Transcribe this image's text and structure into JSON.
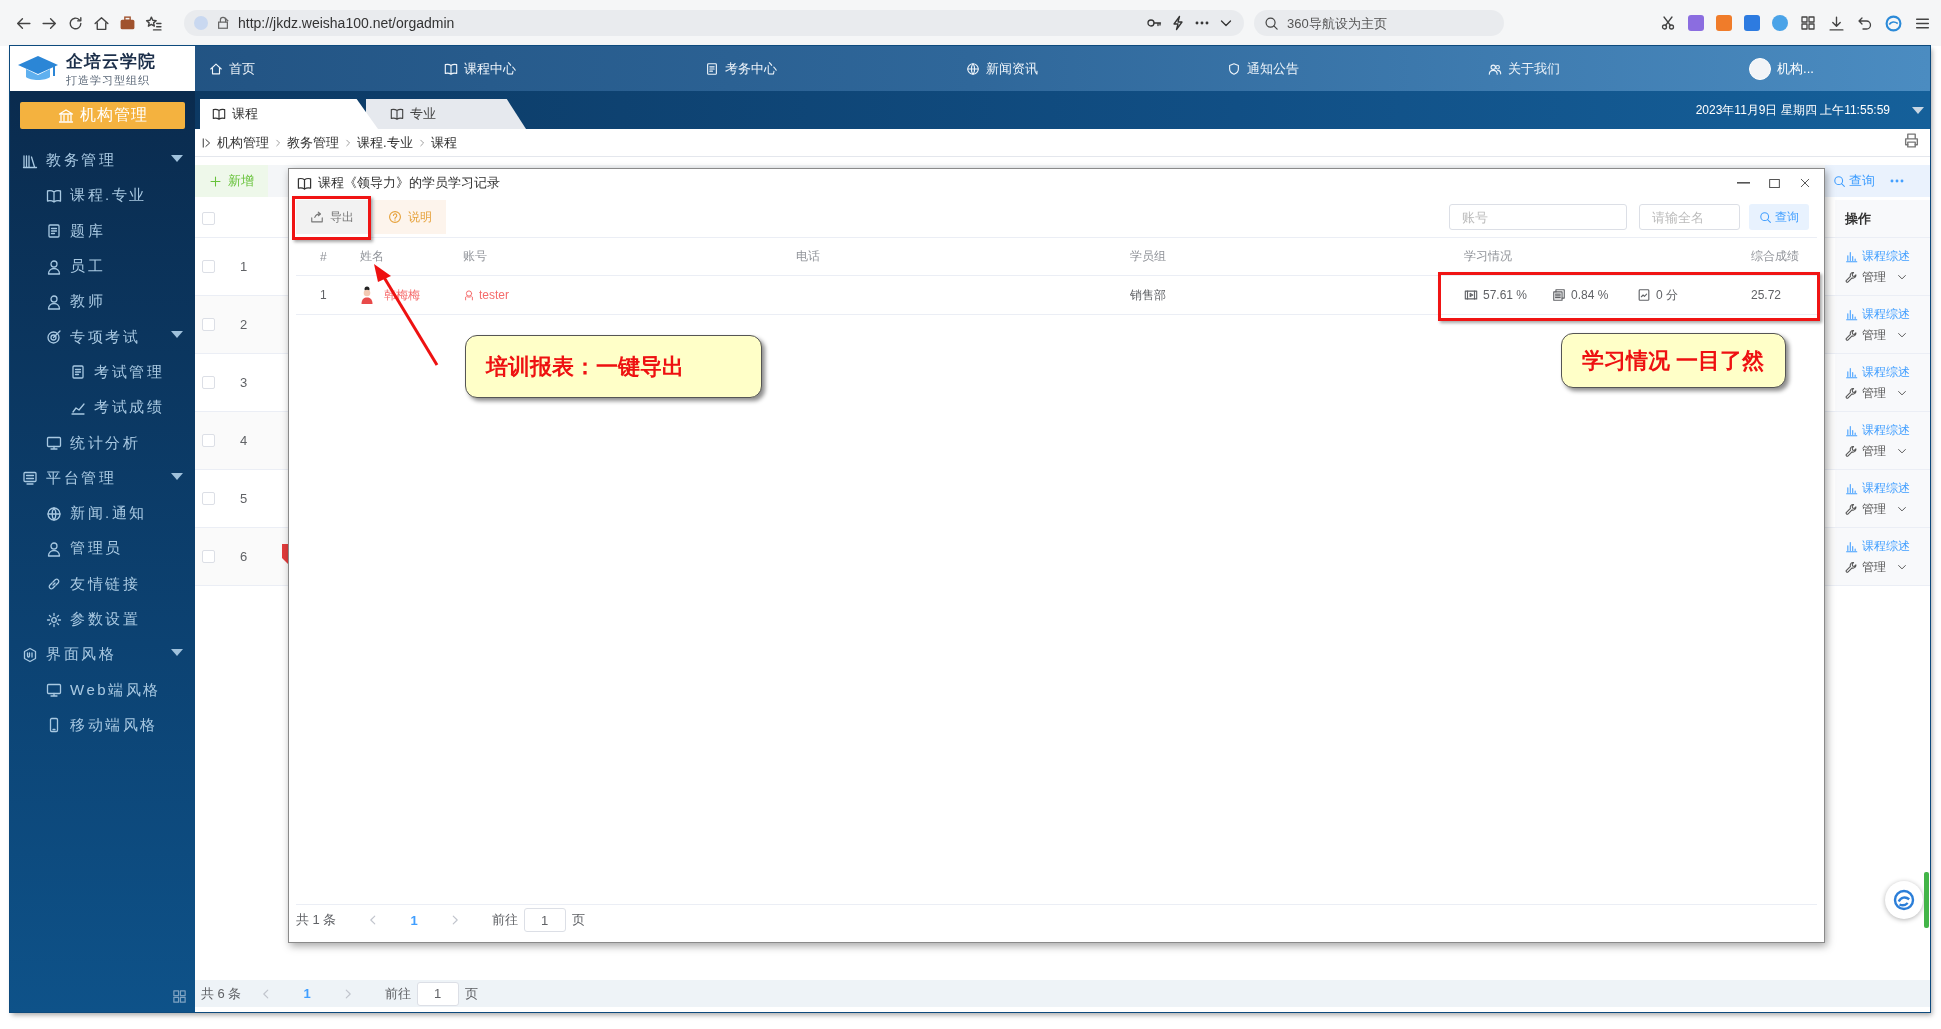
{
  "browser": {
    "url": "http://jkdz.weisha100.net/orgadmin",
    "search": {
      "placeholder": "360导航设为主页"
    }
  },
  "header": {
    "logo_title": "企培云学院",
    "logo_subtitle": "打造学习型组织",
    "user": "机构...",
    "nav": [
      {
        "label": "首页"
      },
      {
        "label": "课程中心"
      },
      {
        "label": "考务中心"
      },
      {
        "label": "新闻资讯"
      },
      {
        "label": "通知公告"
      },
      {
        "label": "关于我们"
      }
    ]
  },
  "tabs": [
    {
      "label": "课程",
      "selected": true
    },
    {
      "label": "专业",
      "selected": false
    }
  ],
  "datetime": "2023年11月9日 星期四 上午11:55:59",
  "sidebar": {
    "title": "机构管理",
    "items": [
      {
        "label": "教务管理",
        "expanded": true,
        "children": [
          {
            "label": "课程.专业"
          },
          {
            "label": "题库"
          },
          {
            "label": "员工"
          },
          {
            "label": "教师"
          },
          {
            "label": "专项考试",
            "expanded": true,
            "children": [
              {
                "label": "考试管理"
              },
              {
                "label": "考试成绩"
              }
            ]
          },
          {
            "label": "统计分析"
          }
        ]
      },
      {
        "label": "平台管理",
        "expanded": true,
        "children": [
          {
            "label": "新闻.通知"
          },
          {
            "label": "管理员"
          },
          {
            "label": "友情链接"
          },
          {
            "label": "参数设置"
          }
        ]
      },
      {
        "label": "界面风格",
        "expanded": true,
        "children": [
          {
            "label": "Web端风格"
          },
          {
            "label": "移动端风格"
          }
        ]
      }
    ]
  },
  "breadcrumb": [
    "机构管理",
    "教务管理",
    "课程.专业",
    "课程"
  ],
  "main": {
    "add_button": "新增",
    "search_button": "查询",
    "actions_column": "操作",
    "select_all_checked": false,
    "rows": [
      {
        "index": "1",
        "checked": false,
        "tagged": false,
        "link": "课程综述",
        "manage": "管理"
      },
      {
        "index": "2",
        "checked": false,
        "tagged": false,
        "link": "课程综述",
        "manage": "管理"
      },
      {
        "index": "3",
        "checked": false,
        "tagged": false,
        "link": "课程综述",
        "manage": "管理"
      },
      {
        "index": "4",
        "checked": false,
        "tagged": false,
        "link": "课程综述",
        "manage": "管理"
      },
      {
        "index": "5",
        "checked": false,
        "tagged": false,
        "link": "课程综述",
        "manage": "管理"
      },
      {
        "index": "6",
        "checked": false,
        "tagged": true,
        "link": "课程综述",
        "manage": "管理"
      }
    ],
    "pagination": {
      "total": "共 6 条",
      "current": "1",
      "goto": "前往",
      "goto_value": "1",
      "suffix": "页"
    }
  },
  "dialog": {
    "title": "课程《领导力》的学员学习记录",
    "export_button": "导出",
    "help_button": "说明",
    "account_field": {
      "placeholder": "账号"
    },
    "name_field": {
      "placeholder": "请输全名"
    },
    "search_button": "查询",
    "columns": [
      "#",
      "姓名",
      "账号",
      "电话",
      "学员组",
      "学习情况",
      "综合成绩"
    ],
    "rows": [
      {
        "index": "1",
        "name": "韩梅梅",
        "account": "tester",
        "group": "销售部",
        "video": "57.61 %",
        "questions": "0.84 %",
        "exam": "0 分",
        "score": "25.72"
      }
    ],
    "pagination": {
      "total": "共 1 条",
      "current": "1",
      "goto": "前往",
      "goto_value": "1",
      "suffix": "页"
    }
  },
  "annotations": [
    {
      "kind": "callout",
      "text": "培训报表：一键导出"
    },
    {
      "kind": "callout",
      "text": "学习情况 一目了然"
    }
  ]
}
